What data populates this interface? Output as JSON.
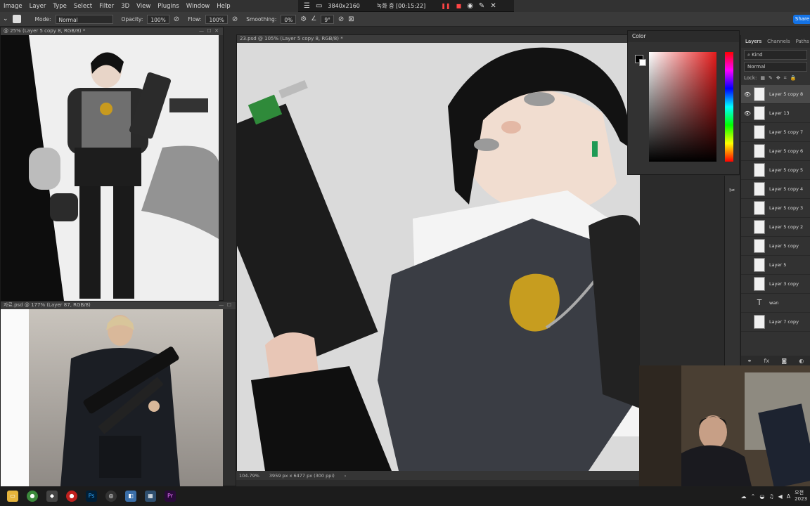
{
  "menu": [
    "Image",
    "Layer",
    "Type",
    "Select",
    "Filter",
    "3D",
    "View",
    "Plugins",
    "Window",
    "Help"
  ],
  "recorder": {
    "resolution": "3840x2160",
    "status": "녹화 중 [00:15:22]"
  },
  "options": {
    "mode_label": "Mode:",
    "mode_value": "Normal",
    "opacity_label": "Opacity:",
    "opacity_value": "100%",
    "flow_label": "Flow:",
    "flow_value": "100%",
    "smoothing_label": "Smoothing:",
    "smoothing_value": "0%",
    "angle_value": "9°",
    "share_label": "Share"
  },
  "documents": {
    "left_top_tab": "@ 25% (Layer 5 copy 8, RGB/8) *",
    "left_bottom_tab": "자료.psd @ 177% (Layer 87, RGB/8)",
    "main_tab": "23.psd @ 105% (Layer 5 copy 8, RGB/8) *"
  },
  "color_panel": {
    "title": "Color",
    "fg": "#000000",
    "bg": "#ffffff"
  },
  "layers_panel": {
    "tabs": [
      "Layers",
      "Channels",
      "Paths"
    ],
    "kind_label": "Kind",
    "blend_mode": "Normal",
    "lock_label": "Lock:",
    "layers": [
      {
        "name": "Layer 5 copy 8",
        "visible": true,
        "selected": true
      },
      {
        "name": "Layer 13",
        "visible": true,
        "selected": false
      },
      {
        "name": "Layer 5 copy 7",
        "visible": false,
        "selected": false
      },
      {
        "name": "Layer 5 copy 6",
        "visible": false,
        "selected": false
      },
      {
        "name": "Layer 5 copy 5",
        "visible": false,
        "selected": false
      },
      {
        "name": "Layer 5 copy 4",
        "visible": false,
        "selected": false
      },
      {
        "name": "Layer 5 copy 3",
        "visible": false,
        "selected": false
      },
      {
        "name": "Layer 5 copy 2",
        "visible": false,
        "selected": false
      },
      {
        "name": "Layer 5 copy",
        "visible": false,
        "selected": false
      },
      {
        "name": "Layer 5",
        "visible": false,
        "selected": false
      },
      {
        "name": "Layer 3 copy",
        "visible": false,
        "selected": false
      },
      {
        "name": "wan",
        "visible": false,
        "selected": false,
        "type": "text"
      },
      {
        "name": "Layer 7 copy",
        "visible": false,
        "selected": false
      }
    ]
  },
  "status": {
    "zoom": "104.79%",
    "doc_size": "3959 px x 6477 px (300 ppi)"
  },
  "tray": {
    "time_fragment": "오전",
    "date_fragment": "2023"
  }
}
